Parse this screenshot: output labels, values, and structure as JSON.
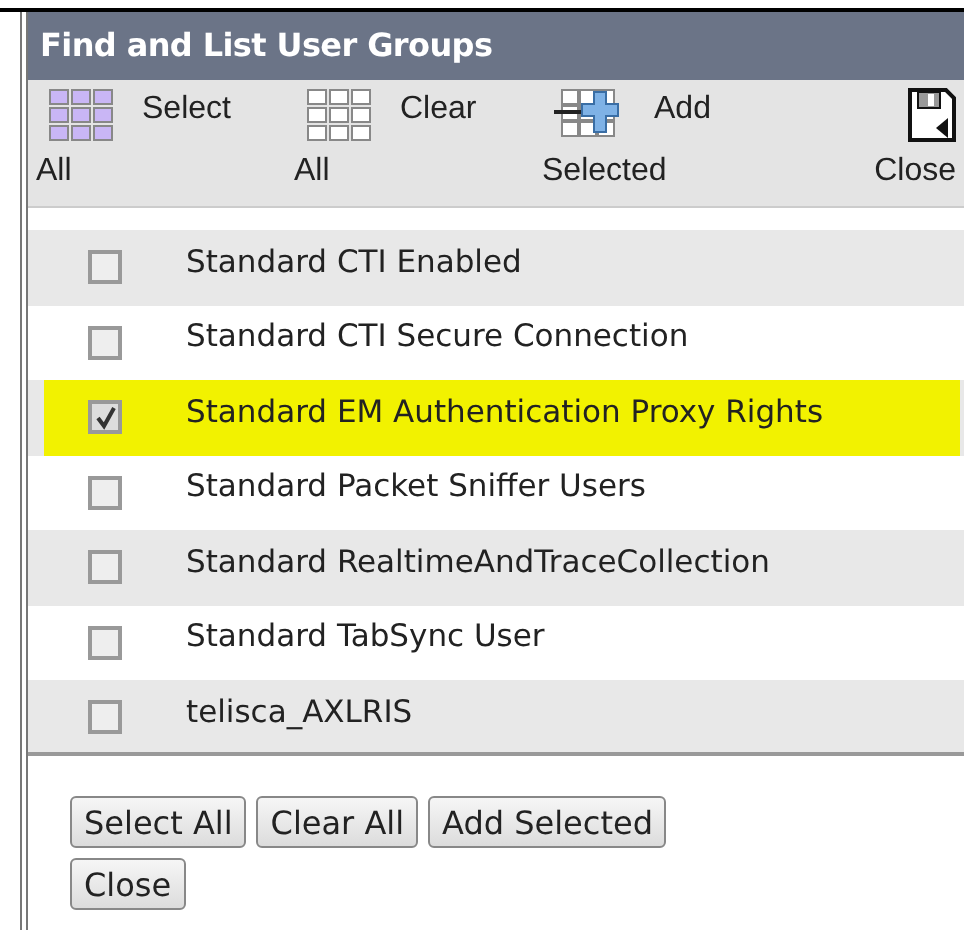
{
  "window": {
    "title": "Find and List User Groups"
  },
  "toolbar": [
    {
      "kind": "select_all",
      "lines": [
        "Select",
        "All"
      ]
    },
    {
      "kind": "clear_all",
      "lines": [
        "Clear",
        "All"
      ]
    },
    {
      "kind": "add_selected",
      "lines": [
        "Add",
        "Selected"
      ]
    },
    {
      "kind": "close",
      "lines": [
        "Close"
      ]
    }
  ],
  "groups": [
    {
      "name": "Standard CTI Enabled",
      "checked": false,
      "selected": false
    },
    {
      "name": "Standard CTI Secure Connection",
      "checked": false,
      "selected": false
    },
    {
      "name": "Standard EM Authentication Proxy Rights",
      "checked": true,
      "selected": true
    },
    {
      "name": "Standard Packet Sniffer Users",
      "checked": false,
      "selected": false
    },
    {
      "name": "Standard RealtimeAndTraceCollection",
      "checked": false,
      "selected": false
    },
    {
      "name": "Standard TabSync User",
      "checked": false,
      "selected": false
    },
    {
      "name": "telisca_AXLRIS",
      "checked": false,
      "selected": false
    }
  ],
  "buttons": [
    "Select All",
    "Clear All",
    "Add Selected",
    "Close"
  ]
}
